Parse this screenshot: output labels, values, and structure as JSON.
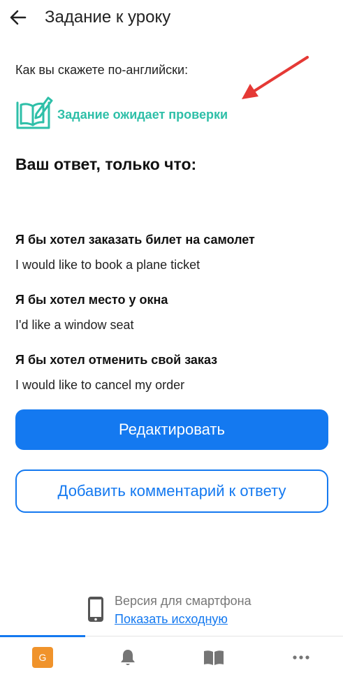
{
  "header": {
    "title": "Задание к уроку",
    "back_icon": "arrow-left-icon"
  },
  "question": "Как вы скажете по-английски:",
  "status": {
    "text": "Задание ожидает проверки",
    "icon": "book-pencil-icon",
    "color": "#2ebfa8"
  },
  "answer_heading": "Ваш ответ, только что:",
  "answers": [
    {
      "question": "Я бы хотел заказать билет на самолет",
      "answer": "I would like to book a plane ticket"
    },
    {
      "question": "Я бы хотел место у окна",
      "answer": "I'd like a window seat"
    },
    {
      "question": "Я бы хотел отменить свой заказ",
      "answer": "I would like to cancel my order"
    }
  ],
  "buttons": {
    "edit": "Редактировать",
    "add_comment": "Добавить комментарий к ответу"
  },
  "footer": {
    "version_label": "Версия для смартфона",
    "show_original": "Показать исходную"
  },
  "bottom_nav": {
    "avatar_letter": "G",
    "items": [
      "avatar",
      "bell-icon",
      "book-icon",
      "more-icon"
    ]
  },
  "colors": {
    "accent": "#1479f0",
    "status": "#2ebfa8",
    "annotation": "#e53935",
    "avatar": "#f0932b"
  }
}
